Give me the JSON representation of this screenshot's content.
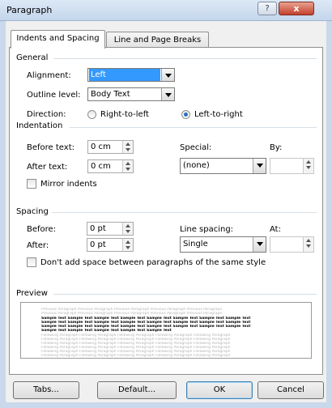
{
  "window": {
    "title": "Paragraph",
    "help_label": "?",
    "close_label": "x"
  },
  "tabs": [
    {
      "label": "Indents and Spacing",
      "active": true
    },
    {
      "label": "Line and Page Breaks",
      "active": false
    }
  ],
  "general": {
    "section_label": "General",
    "alignment_label": "Alignment:",
    "alignment_value": "Left",
    "outline_label": "Outline level:",
    "outline_value": "Body Text",
    "direction_label": "Direction:",
    "direction_options": [
      {
        "label": "Right-to-left",
        "selected": false
      },
      {
        "label": "Left-to-right",
        "selected": true
      }
    ]
  },
  "indentation": {
    "section_label": "Indentation",
    "before_label": "Before text:",
    "before_value": "0 cm",
    "after_label": "After text:",
    "after_value": "0 cm",
    "special_label": "Special:",
    "special_value": "(none)",
    "by_label": "By:",
    "by_value": "",
    "mirror_label": "Mirror indents",
    "mirror_checked": false
  },
  "spacing": {
    "section_label": "Spacing",
    "before_label": "Before:",
    "before_value": "0 pt",
    "after_label": "After:",
    "after_value": "0 pt",
    "line_label": "Line spacing:",
    "line_value": "Single",
    "at_label": "At:",
    "at_value": "",
    "dont_add_label": "Don't add space between paragraphs of the same style",
    "dont_add_checked": false
  },
  "preview": {
    "section_label": "Preview",
    "previous_lines": [
      "Previous Paragraph Previous Paragraph Previous Paragraph Previous Paragraph Previous Paragraph",
      "Previous Paragraph Previous Paragraph Previous Paragraph Previous Paragraph Previous Paragraph"
    ],
    "sample_lines": [
      "Sample Text Sample Text Sample Text Sample Text Sample Text Sample Text Sample Text Sample Text",
      "Sample Text Sample Text Sample Text Sample Text Sample Text Sample Text Sample Text Sample Text",
      "Sample Text Sample Text Sample Text Sample Text Sample Text Sample Text Sample Text Sample Text",
      "Sample Text Sample Text Sample Text Sample Text Sample Text"
    ],
    "following_lines": [
      "Following Paragraph Following Paragraph Following Paragraph Following Paragraph Following Paragraph",
      "Following Paragraph Following Paragraph Following Paragraph Following Paragraph Following Paragraph",
      "Following Paragraph Following Paragraph Following Paragraph Following Paragraph Following Paragraph",
      "Following Paragraph Following Paragraph Following Paragraph Following Paragraph Following Paragraph",
      "Following Paragraph Following Paragraph Following Paragraph Following Paragraph Following Paragraph",
      "Following Paragraph Following Paragraph Following Paragraph Following Paragraph Following Paragraph",
      "Following Paragraph Following Paragraph Following Paragraph Following Paragraph Following Paragraph"
    ]
  },
  "buttons": {
    "tabs_label": "Tabs...",
    "default_label": "Default...",
    "ok_label": "OK",
    "cancel_label": "Cancel"
  }
}
